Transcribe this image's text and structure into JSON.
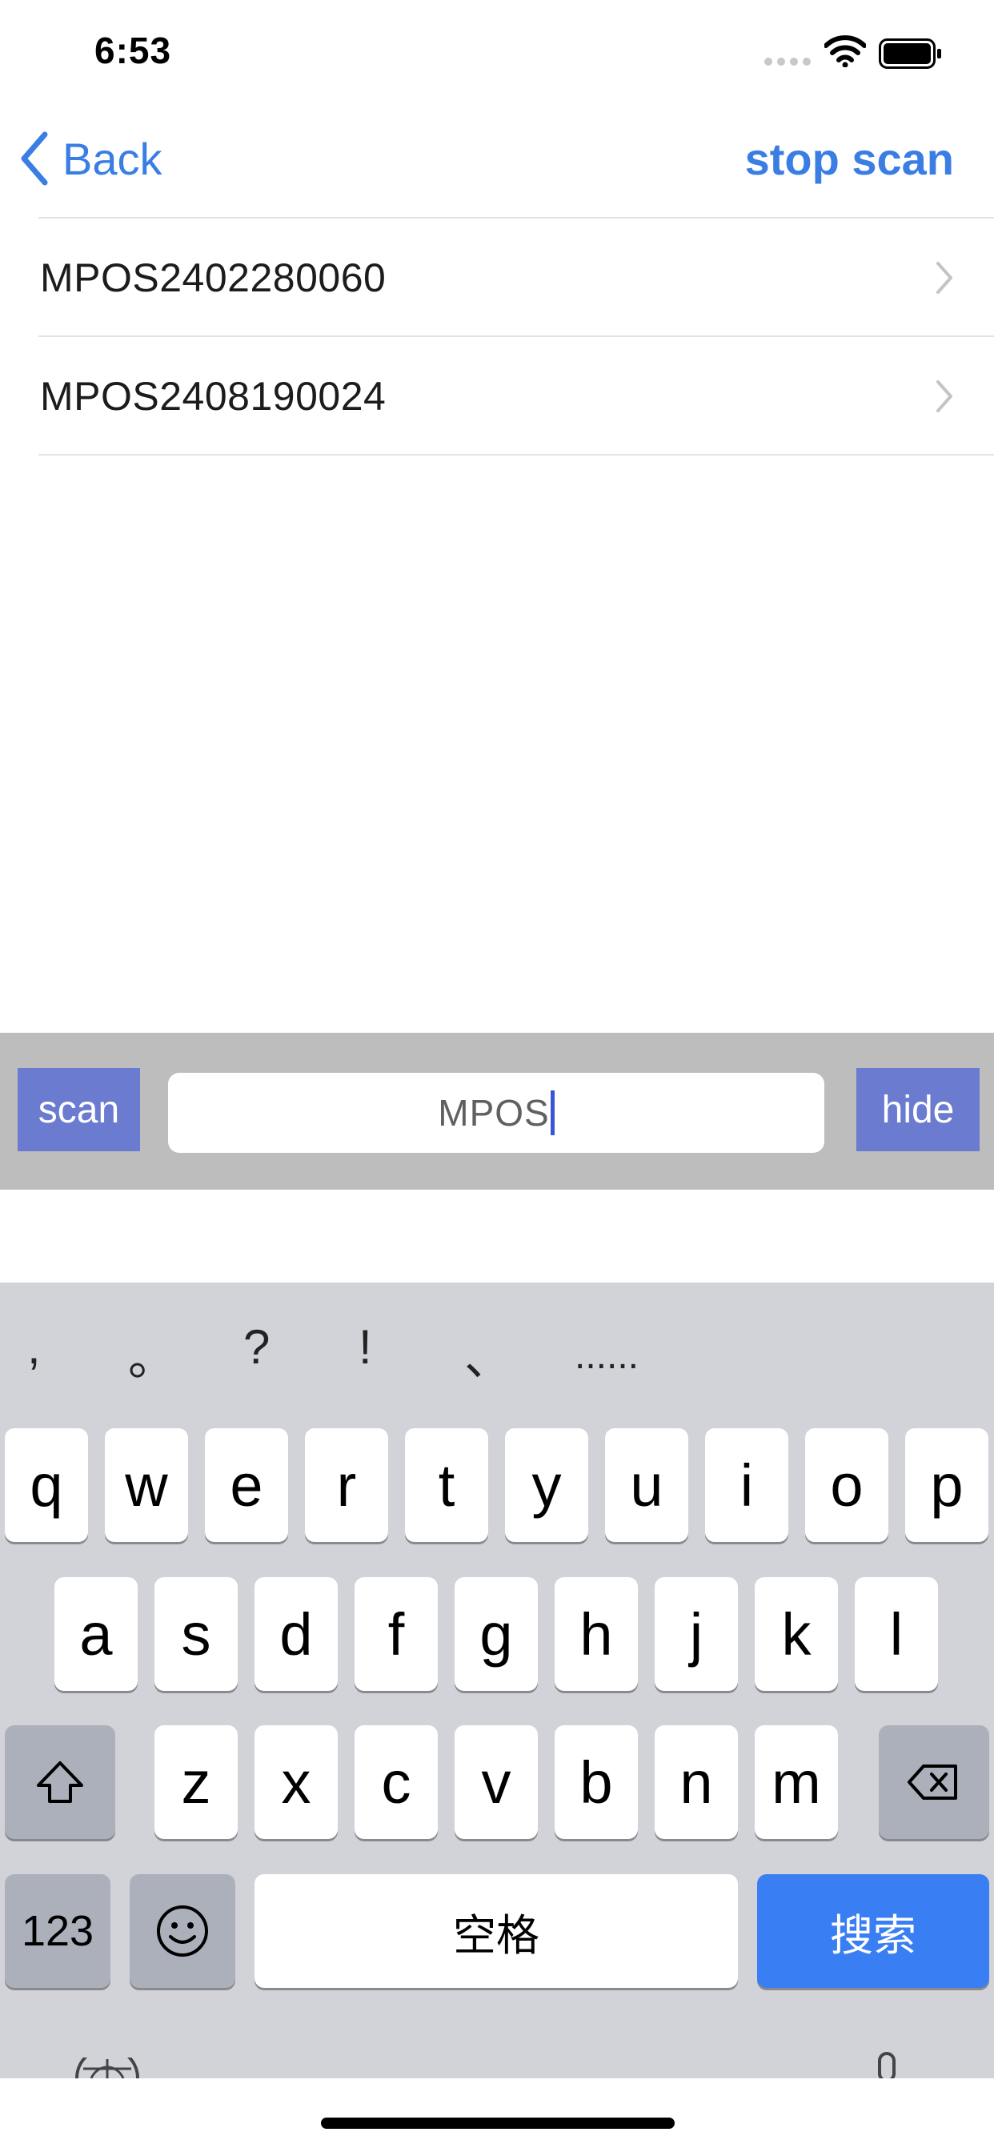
{
  "status_bar": {
    "time": "6:53"
  },
  "nav": {
    "back_label": "Back",
    "stop_scan_label": "stop scan"
  },
  "devices": [
    {
      "name": "MPOS2402280060"
    },
    {
      "name": "MPOS2408190024"
    }
  ],
  "toolbar": {
    "scan_label": "scan",
    "search_value": "MPOS",
    "hide_label": "hide"
  },
  "keyboard": {
    "punctuation": [
      ",",
      "。",
      "?",
      "!",
      "、",
      "......"
    ],
    "row1": [
      "q",
      "w",
      "e",
      "r",
      "t",
      "y",
      "u",
      "i",
      "o",
      "p"
    ],
    "row2": [
      "a",
      "s",
      "d",
      "f",
      "g",
      "h",
      "j",
      "k",
      "l"
    ],
    "row3": [
      "z",
      "x",
      "c",
      "v",
      "b",
      "n",
      "m"
    ],
    "numbers_label": "123",
    "space_label": "空格",
    "search_label": "搜索"
  },
  "colors": {
    "accent": "#3a7ee4",
    "toolbar_button": "#6a7bd0",
    "keyboard_bg": "#d1d3d9"
  }
}
